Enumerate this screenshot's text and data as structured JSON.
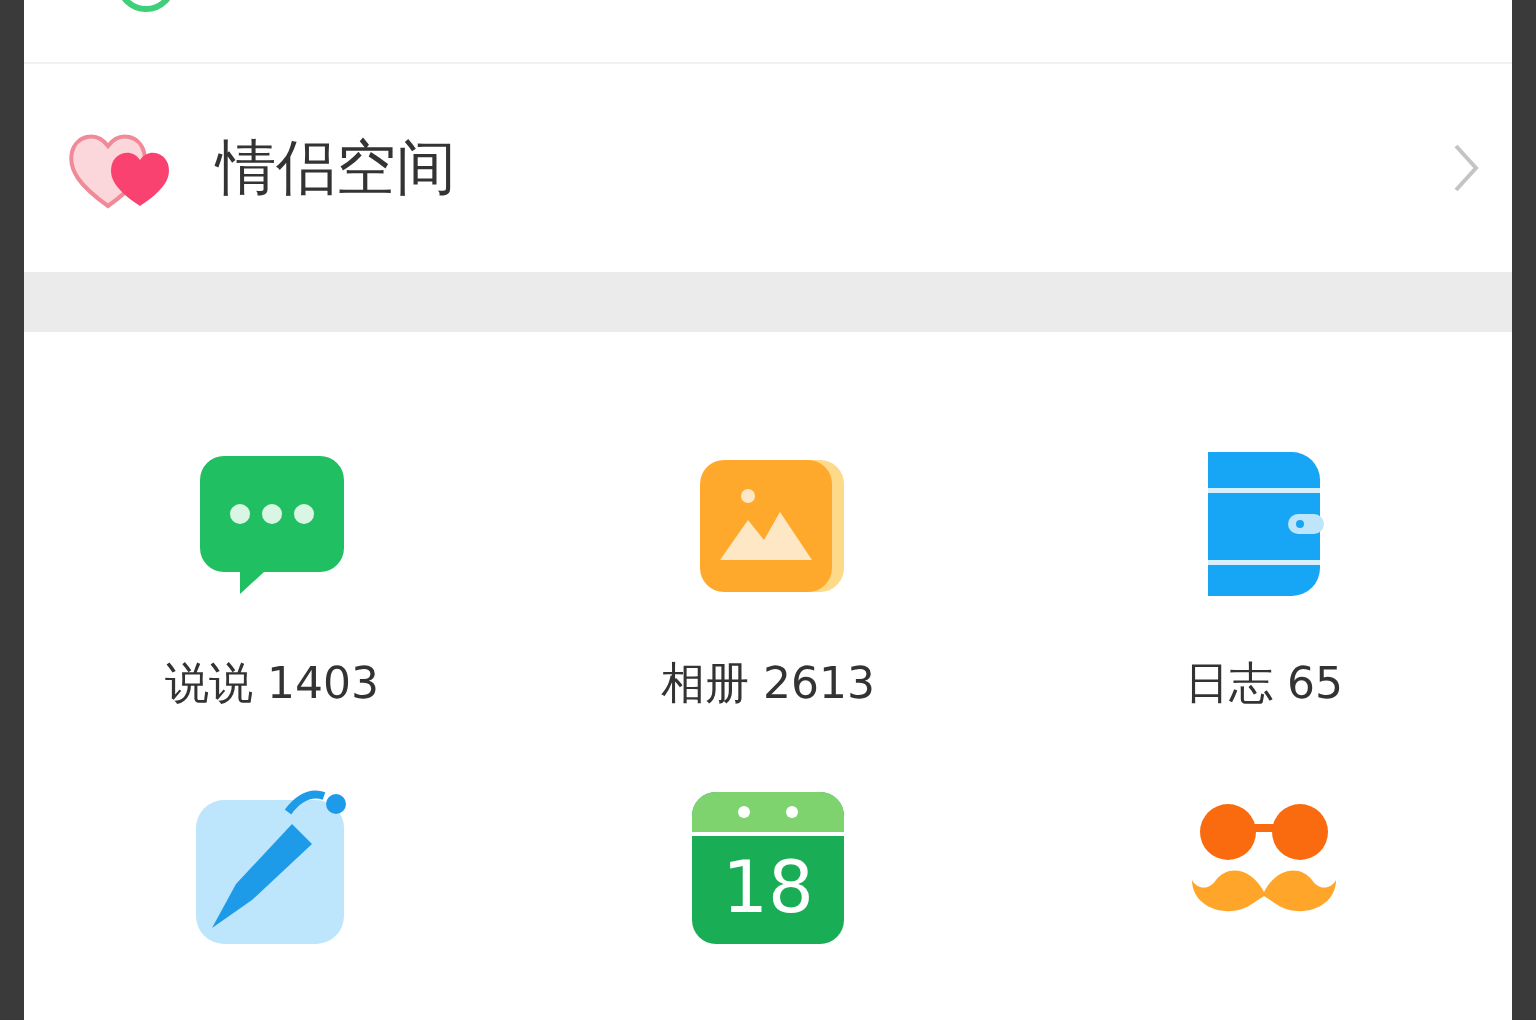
{
  "couple_row": {
    "label": "情侣空间"
  },
  "grid": [
    {
      "kind": "chat",
      "label": "说说 1403"
    },
    {
      "kind": "album",
      "label": "相册 2613"
    },
    {
      "kind": "diary",
      "label": "日志 65"
    },
    {
      "kind": "pen"
    },
    {
      "kind": "calendar",
      "day": "18"
    },
    {
      "kind": "mustache"
    }
  ]
}
